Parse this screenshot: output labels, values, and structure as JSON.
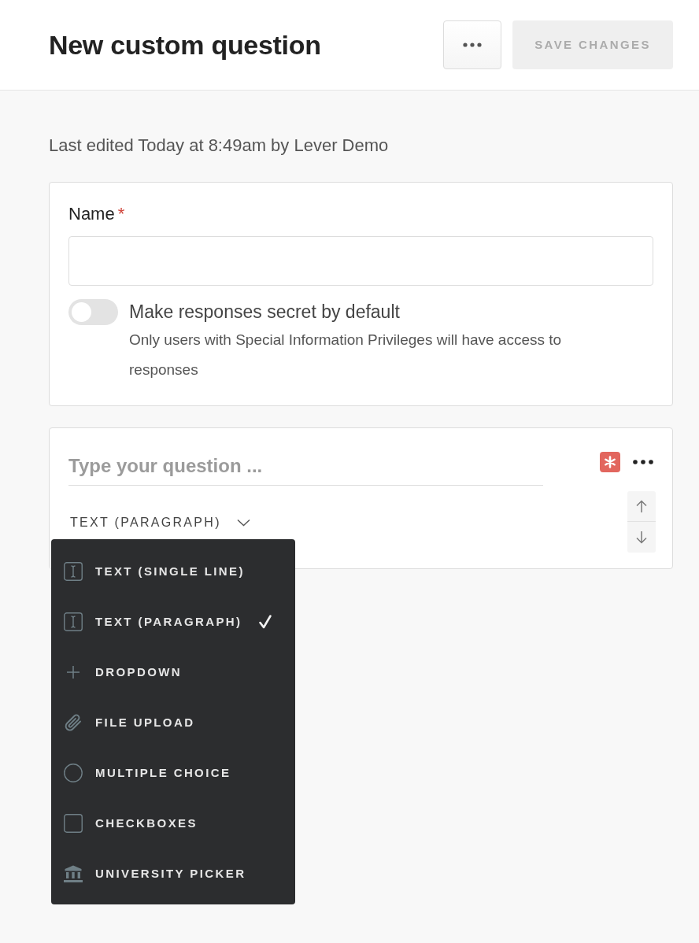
{
  "header": {
    "title": "New custom question",
    "save_button": {
      "label": "SAVE CHANGES",
      "disabled": true
    }
  },
  "last_edited": "Last edited Today at 8:49am by Lever Demo",
  "name_card": {
    "label": "Name",
    "required_mark": "*",
    "secret_toggle": {
      "label": "Make responses secret by default",
      "on": false,
      "help": "Only users with Special Information Privileges will have access to responses"
    }
  },
  "question_card": {
    "question_field": {
      "placeholder": "Type your question ..."
    },
    "required": true,
    "type_select": {
      "label": "TEXT (PARAGRAPH)",
      "expanded": true
    },
    "type_menu": [
      {
        "label": "TEXT (SINGLE LINE)",
        "kind": "text",
        "selected": false
      },
      {
        "label": "TEXT (PARAGRAPH)",
        "kind": "text",
        "selected": true
      },
      {
        "label": "DROPDOWN",
        "kind": "plus",
        "selected": false
      },
      {
        "label": "FILE UPLOAD",
        "kind": "attachment",
        "selected": false
      },
      {
        "label": "MULTIPLE CHOICE",
        "kind": "radio",
        "selected": false
      },
      {
        "label": "CHECKBOXES",
        "kind": "checkbox",
        "selected": false
      },
      {
        "label": "UNIVERSITY PICKER",
        "kind": "institution",
        "selected": false
      }
    ]
  }
}
